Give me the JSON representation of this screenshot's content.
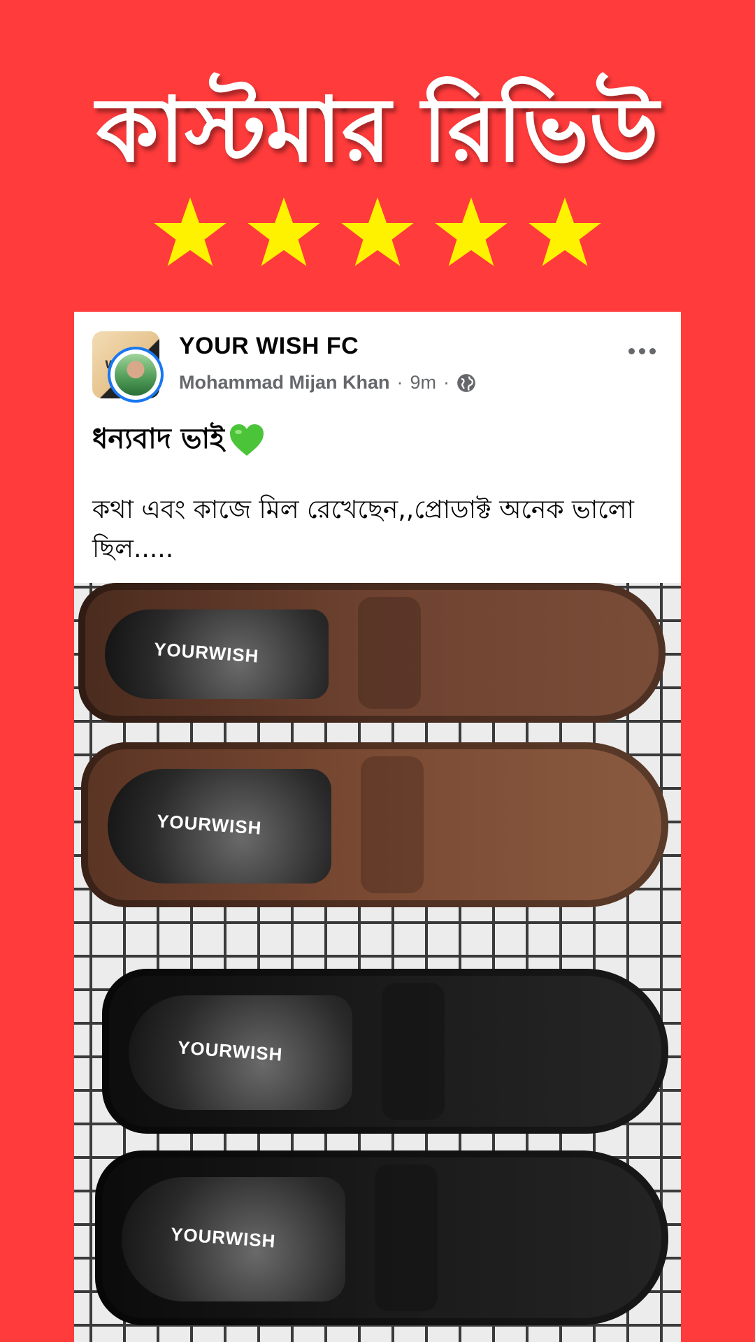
{
  "banner": {
    "headline": "কাস্টমার রিভিউ",
    "rating": 5,
    "rating_max": 5,
    "star_color": "#fff200",
    "background_color": "#ff3b3b"
  },
  "post": {
    "page_name": "YOUR WISH FC",
    "author": "Mohammad Mijan Khan",
    "separator": "·",
    "time": "9m",
    "privacy_icon": "globe-icon",
    "more_icon": "more-options-icon",
    "title": "ধন্যবাদ ভাই",
    "title_emoji": "green-heart-icon",
    "body": "কথা এবং কাজে মিল রেখেছেন,,প্রোডাক্ট  অনেক ভালো ছিল.....",
    "photo": {
      "brand_labels": [
        "YOURWISH",
        "YOURWISH",
        "YOURWISH",
        "YOURWISH"
      ],
      "subject": "shoes"
    }
  }
}
